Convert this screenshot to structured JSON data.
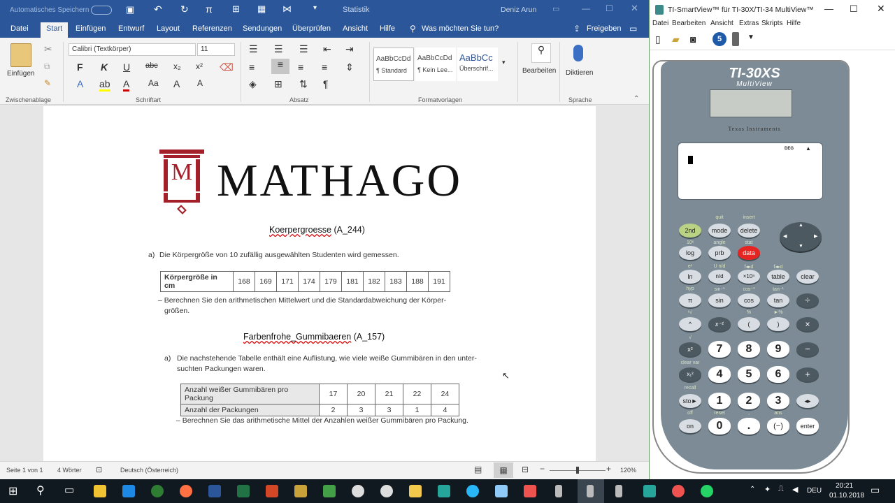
{
  "word": {
    "autosave": "Automatisches Speichern",
    "title": "Statistik",
    "user": "Deniz Arun",
    "tabs": [
      "Datei",
      "Start",
      "Einfügen",
      "Entwurf",
      "Layout",
      "Referenzen",
      "Sendungen",
      "Überprüfen",
      "Ansicht",
      "Hilfe"
    ],
    "tell_me": "Was möchten Sie tun?",
    "share": "Freigeben",
    "ribbon": {
      "paste": "Einfügen",
      "clipboard": "Zwischenablage",
      "font_name": "Calibri (Textkörper)",
      "font_size": "11",
      "font_group": "Schriftart",
      "paragraph": "Absatz",
      "styles": [
        "AaBbCcDd",
        "AaBbCcDd",
        "AaBbCc"
      ],
      "style_names": [
        "¶ Standard",
        "¶ Kein Lee...",
        "Überschrif..."
      ],
      "styles_group": "Formatvorlagen",
      "edit": "Bearbeiten",
      "dictate": "Diktieren",
      "speech": "Sprache"
    },
    "doc": {
      "logo": "MATHAGO",
      "logo_letter": "M",
      "h1": "Koerpergroesse",
      "h1_code": "(A_244)",
      "a1_label": "a)",
      "a1_text": "Die Körpergröße von 10 zufällig ausgewählten Studenten wird gemessen.",
      "table1_head": "Körpergröße in cm",
      "table1_values": [
        "168",
        "169",
        "171",
        "174",
        "179",
        "181",
        "182",
        "183",
        "188",
        "191"
      ],
      "task1": "– Berechnen Sie den arithmetischen Mittelwert und die Standardabweichung der Körper-",
      "task1b": "größen.",
      "h2": "Farbenfrohe_Gummibaeren",
      "h2_code": "(A_157)",
      "a2_label": "a)",
      "a2_text": "Die nachstehende Tabelle enthält eine Auflistung, wie viele weiße Gummibären in den unter-",
      "a2_text2": "suchten Packungen waren.",
      "table2_rows": [
        {
          "head": "Anzahl weißer Gummibären pro Packung",
          "values": [
            "17",
            "20",
            "21",
            "22",
            "24"
          ]
        },
        {
          "head": "Anzahl der Packungen",
          "values": [
            "2",
            "3",
            "3",
            "1",
            "4"
          ]
        }
      ],
      "task2": "– Berechnen Sie das arithmetische Mittel der Anzahlen weißer Gummibären pro Packung."
    },
    "status": {
      "page": "Seite 1 von 1",
      "words": "4 Wörter",
      "lang": "Deutsch (Österreich)",
      "zoom": "120%"
    }
  },
  "ti": {
    "title": "TI-SmartView™ für TI-30X/TI-34 MultiView™",
    "menu": [
      "Datei",
      "Bearbeiten",
      "Ansicht",
      "Extras",
      "Skripts",
      "Hilfe"
    ],
    "model": "TI-30XS",
    "model2": "MultiView",
    "brand": "Texas Instruments",
    "deg": "DEG",
    "keys": {
      "r1": [
        "2nd",
        "mode",
        "delete"
      ],
      "r1s": [
        "",
        "quit",
        "insert"
      ],
      "r2": [
        "log",
        "prb",
        "data"
      ],
      "r2s": [
        "10ˣ",
        "angle",
        "stat"
      ],
      "r3": [
        "ln",
        "n/d",
        "×10ⁿ",
        "table",
        "clear"
      ],
      "r3s": [
        "eˣ",
        "U n/d",
        "f◂▸d",
        "f◂▸d",
        "K"
      ],
      "r4": [
        "π",
        "sin",
        "cos",
        "tan",
        "÷"
      ],
      "r4s": [
        "hyp",
        "sin⁻¹",
        "cos⁻¹",
        "tan⁻¹",
        ""
      ],
      "r5": [
        "^",
        "x⁻¹",
        "(",
        ")",
        "×"
      ],
      "r5s": [
        "ˣ√",
        "",
        "%",
        "►%",
        ""
      ],
      "r6": [
        "x²",
        "7",
        "8",
        "9",
        "−"
      ],
      "r6s": [
        "√",
        "",
        "",
        "",
        ""
      ],
      "r7": [
        "x₁²",
        "4",
        "5",
        "6",
        "+"
      ],
      "r7s": [
        "clear var",
        "",
        "",
        "",
        ""
      ],
      "r8": [
        "sto►",
        "1",
        "2",
        "3",
        "◂▸"
      ],
      "r8s": [
        "recall",
        "",
        "",
        "",
        ""
      ],
      "r9": [
        "on",
        "0",
        ".",
        "(−)",
        "enter"
      ],
      "r9s": [
        "off",
        "reset",
        ",",
        "ans",
        ""
      ]
    }
  },
  "taskbar": {
    "lang": "DEU",
    "time": "20:21",
    "date": "01.10.2018"
  }
}
